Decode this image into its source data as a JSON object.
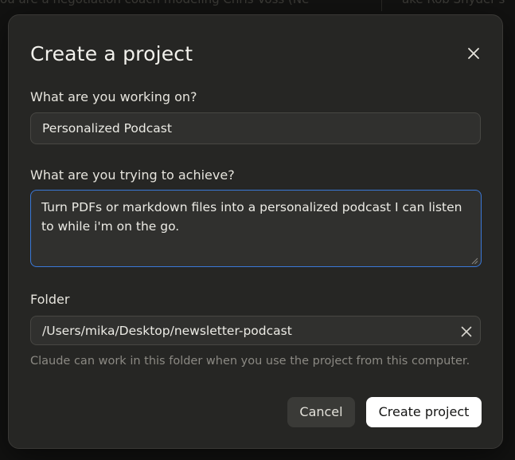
{
  "background": {
    "left_text": "ou are a negotiation coach modeling Chris Voss (Ne",
    "right_text": "ake Rob Snyder's"
  },
  "dialog": {
    "title": "Create a project",
    "close_icon": "close-icon",
    "fields": {
      "working_on": {
        "label": "What are you working on?",
        "value": "Personalized Podcast"
      },
      "achieve": {
        "label": "What are you trying to achieve?",
        "value": "Turn PDFs or markdown files into a personalized podcast I can listen to while i'm on the go."
      },
      "folder": {
        "label": "Folder",
        "value": "/Users/mika/Desktop/newsletter-podcast",
        "clear_icon": "clear-icon",
        "hint": "Claude can work in this folder when you use the project from this computer."
      }
    },
    "buttons": {
      "cancel": "Cancel",
      "create": "Create project"
    }
  },
  "colors": {
    "dialog_bg": "#262624",
    "focus_border": "#3a78d8",
    "primary_button_bg": "#ffffff"
  }
}
